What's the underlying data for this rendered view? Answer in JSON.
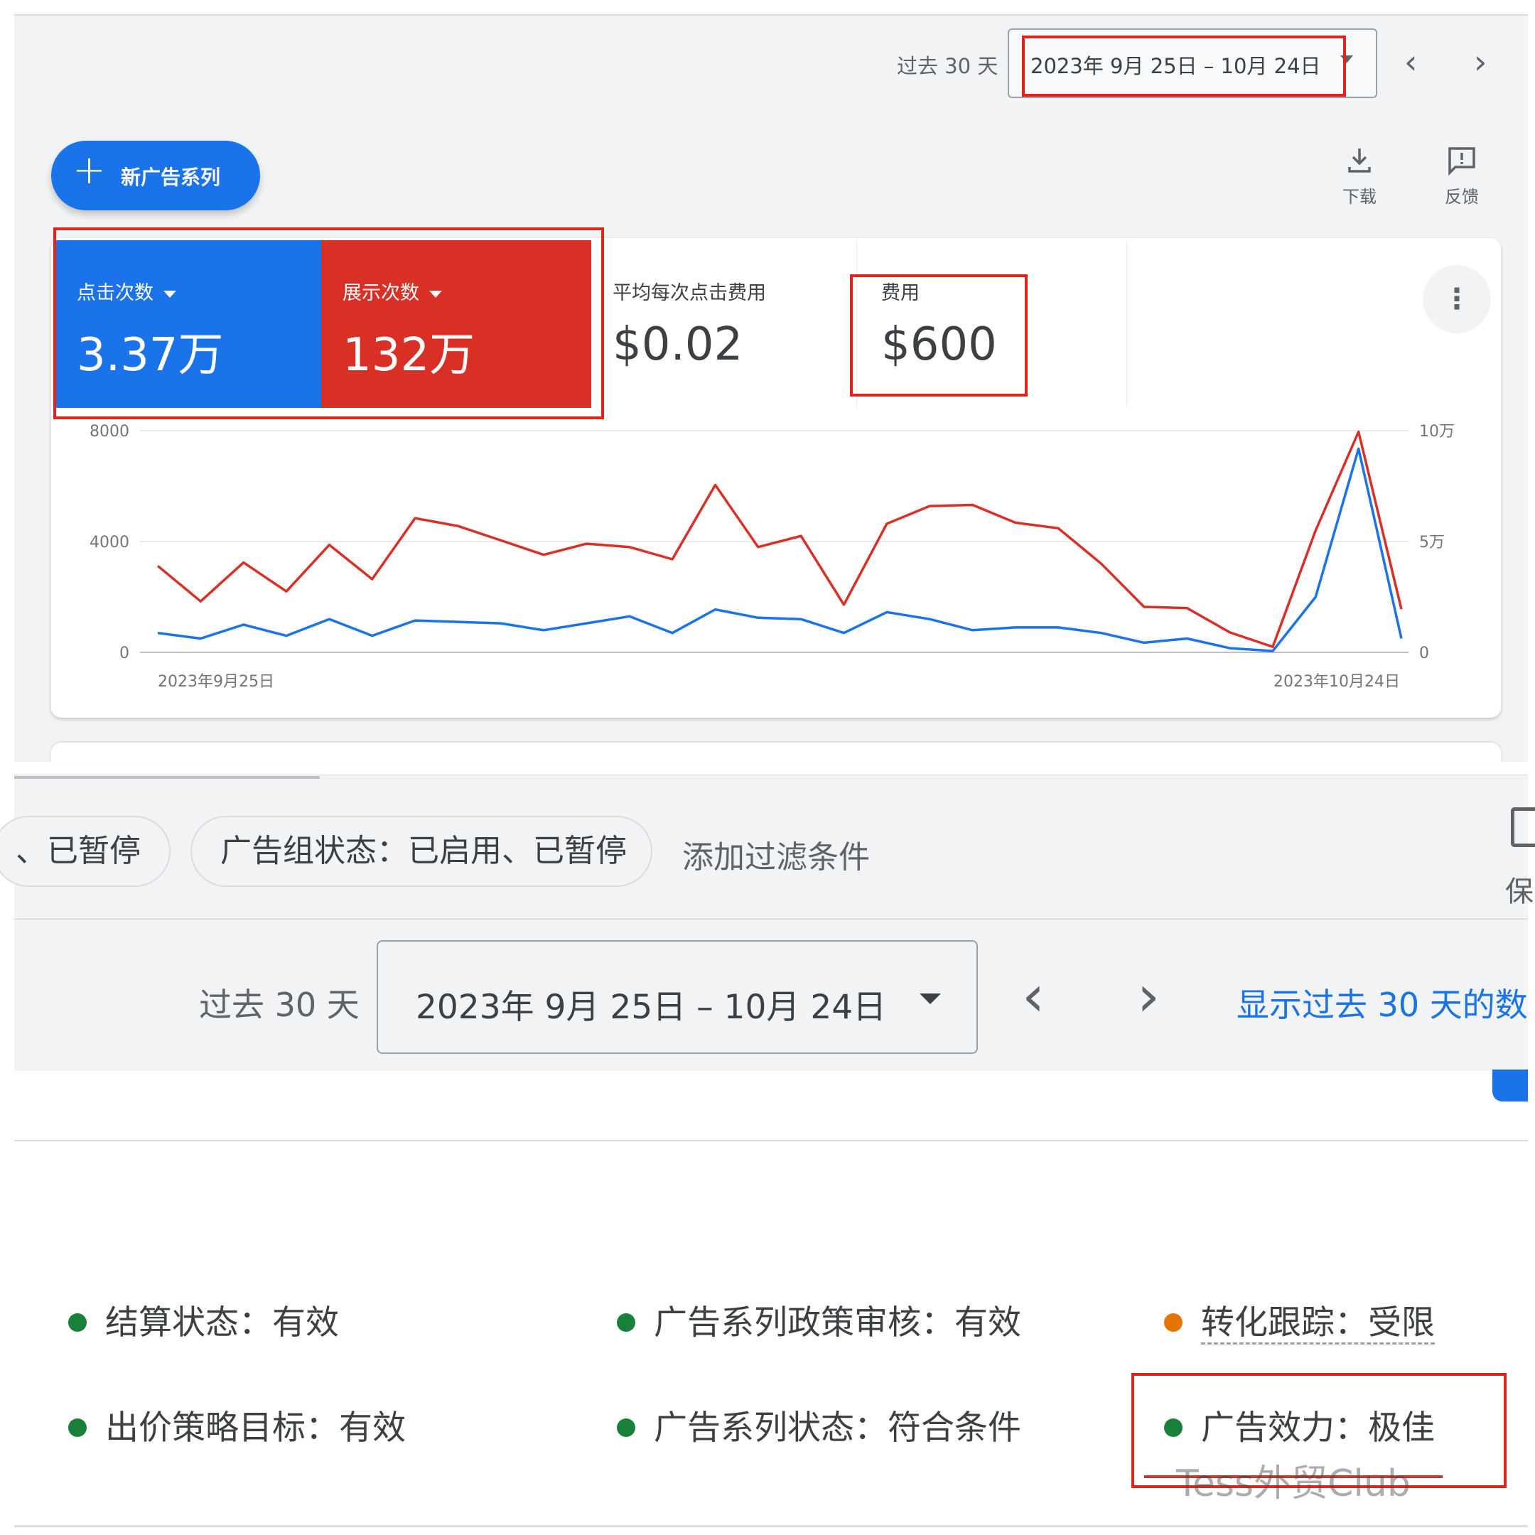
{
  "top_bar": {
    "period_label": "过去 30 天",
    "date_range": "2023年 9月 25日 – 10月 24日",
    "prev_icon": "chevron-left-icon",
    "next_icon": "chevron-right-icon"
  },
  "new_campaign_button": {
    "icon": "plus-icon",
    "label": "新广告系列"
  },
  "toolbar": {
    "download": {
      "icon": "download-icon",
      "label": "下载"
    },
    "feedback": {
      "icon": "feedback-icon",
      "label": "反馈"
    }
  },
  "metrics": [
    {
      "label": "点击次数",
      "value": "3.37万",
      "color": "#1a73e8"
    },
    {
      "label": "展示次数",
      "value": "132万",
      "color": "#d93025"
    },
    {
      "label": "平均每次点击费用",
      "value": "$0.02"
    },
    {
      "label": "费用",
      "value": "$600"
    }
  ],
  "chart_data": {
    "type": "line",
    "x_start_label": "2023年9月25日",
    "x_end_label": "2023年10月24日",
    "left_axis": {
      "ticks": [
        "8000",
        "4000",
        "0"
      ],
      "ylim": [
        0,
        8000
      ]
    },
    "right_axis": {
      "ticks": [
        "10万",
        "5万",
        "0"
      ],
      "ylim": [
        0,
        100000
      ]
    },
    "series": [
      {
        "axis": "left",
        "color": "#1a73e8",
        "values": [
          700,
          500,
          1000,
          600,
          1200,
          600,
          1150,
          1100,
          1050,
          800,
          1050,
          1300,
          700,
          1550,
          1250,
          1200,
          700,
          1450,
          1200,
          800,
          900,
          900,
          700,
          350,
          500,
          150,
          50,
          2000,
          7350,
          500
        ]
      },
      {
        "axis": "right",
        "color": "#d93025",
        "values": [
          39000,
          23000,
          40500,
          27500,
          48500,
          33000,
          60500,
          57000,
          50500,
          44000,
          49000,
          47500,
          42000,
          75500,
          47500,
          52500,
          21500,
          58000,
          66000,
          66500,
          58500,
          56000,
          40000,
          20500,
          20000,
          9000,
          2500,
          55000,
          99500,
          19500
        ]
      }
    ]
  },
  "filters": {
    "chip1": "、已暂停",
    "chip2": "广告组状态：已启用、已暂停",
    "add_filter": "添加过滤条件",
    "save_icon": "save-icon",
    "save_label": "保"
  },
  "date_row": {
    "period_label": "过去 30 天",
    "date_range": "2023年 9月 25日 – 10月 24日",
    "show_link": "显示过去 30 天的数"
  },
  "statuses": [
    {
      "text": "结算状态：有效",
      "color": "#188038"
    },
    {
      "text": "广告系列政策审核：有效",
      "color": "#188038"
    },
    {
      "text": "转化跟踪：受限",
      "color": "#e37400"
    },
    {
      "text": "出价策略目标：有效",
      "color": "#188038"
    },
    {
      "text": "广告系列状态：符合条件",
      "color": "#188038"
    },
    {
      "text": "广告效力：极佳",
      "color": "#188038"
    }
  ],
  "watermark": "Tess外贸Club",
  "highlight_color": "#e3231b"
}
